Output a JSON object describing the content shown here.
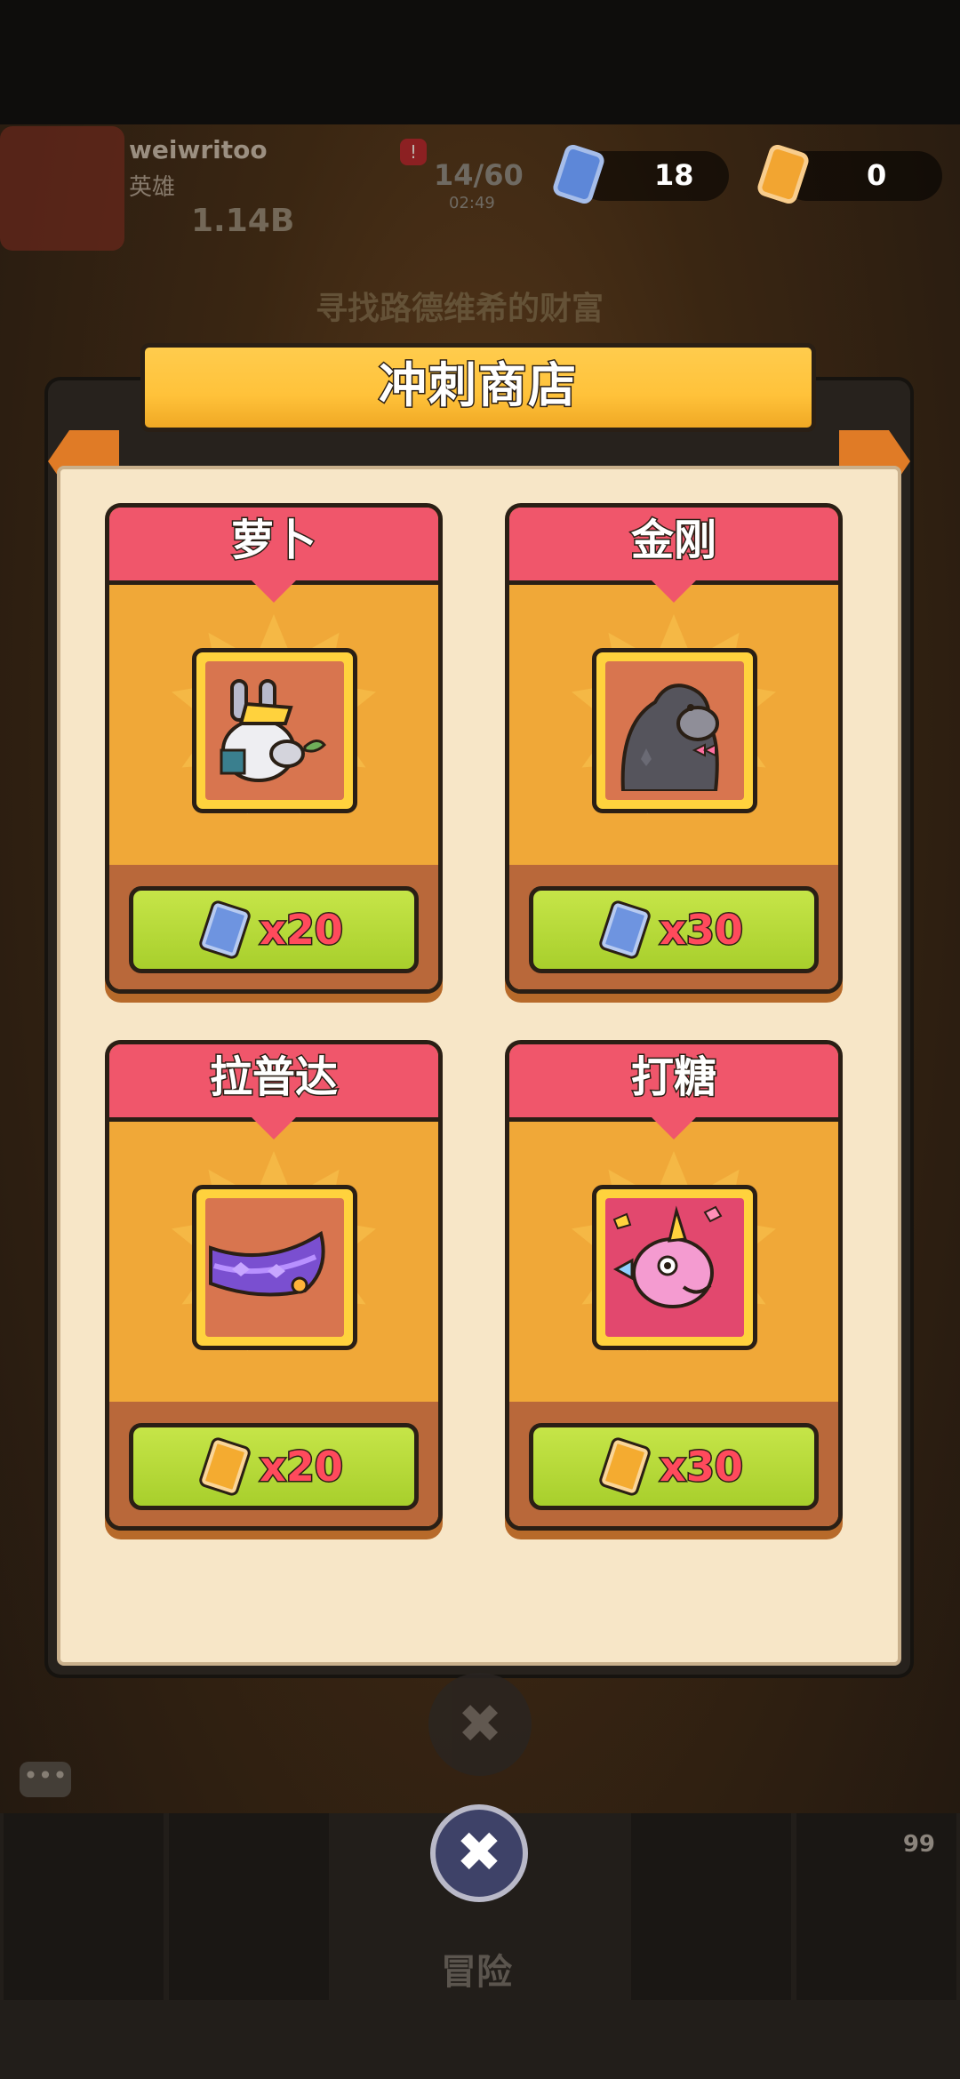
{
  "hud": {
    "player_name": "weiwritoo",
    "player_role": "英雄",
    "player_power": "1.14B",
    "energy": "14/60",
    "energy_timer": "02:49",
    "blue_ticket_count": "18",
    "gold_ticket_count": "0"
  },
  "background": {
    "quest_text": "寻找路德维希的财富",
    "nav_label": "冒险",
    "nav_count": "99"
  },
  "shop": {
    "title": "冲刺商店",
    "items": [
      {
        "name": "萝卜",
        "currency": "blue-ticket",
        "price": "x20"
      },
      {
        "name": "金刚",
        "currency": "blue-ticket",
        "price": "x30"
      },
      {
        "name": "拉普达",
        "currency": "gold-ticket",
        "price": "x20"
      },
      {
        "name": "打糖",
        "currency": "gold-ticket",
        "price": "x30"
      }
    ]
  },
  "colors": {
    "title_yellow": "#ffc23a",
    "card_header_red": "#f0566b",
    "card_orange": "#f0a838",
    "buy_green": "#a8cf2c",
    "price_red": "#ff4a5c",
    "panel_cream": "#f7e6c7",
    "blue_ticket": "#6e94e0",
    "gold_ticket": "#f4ab30"
  }
}
